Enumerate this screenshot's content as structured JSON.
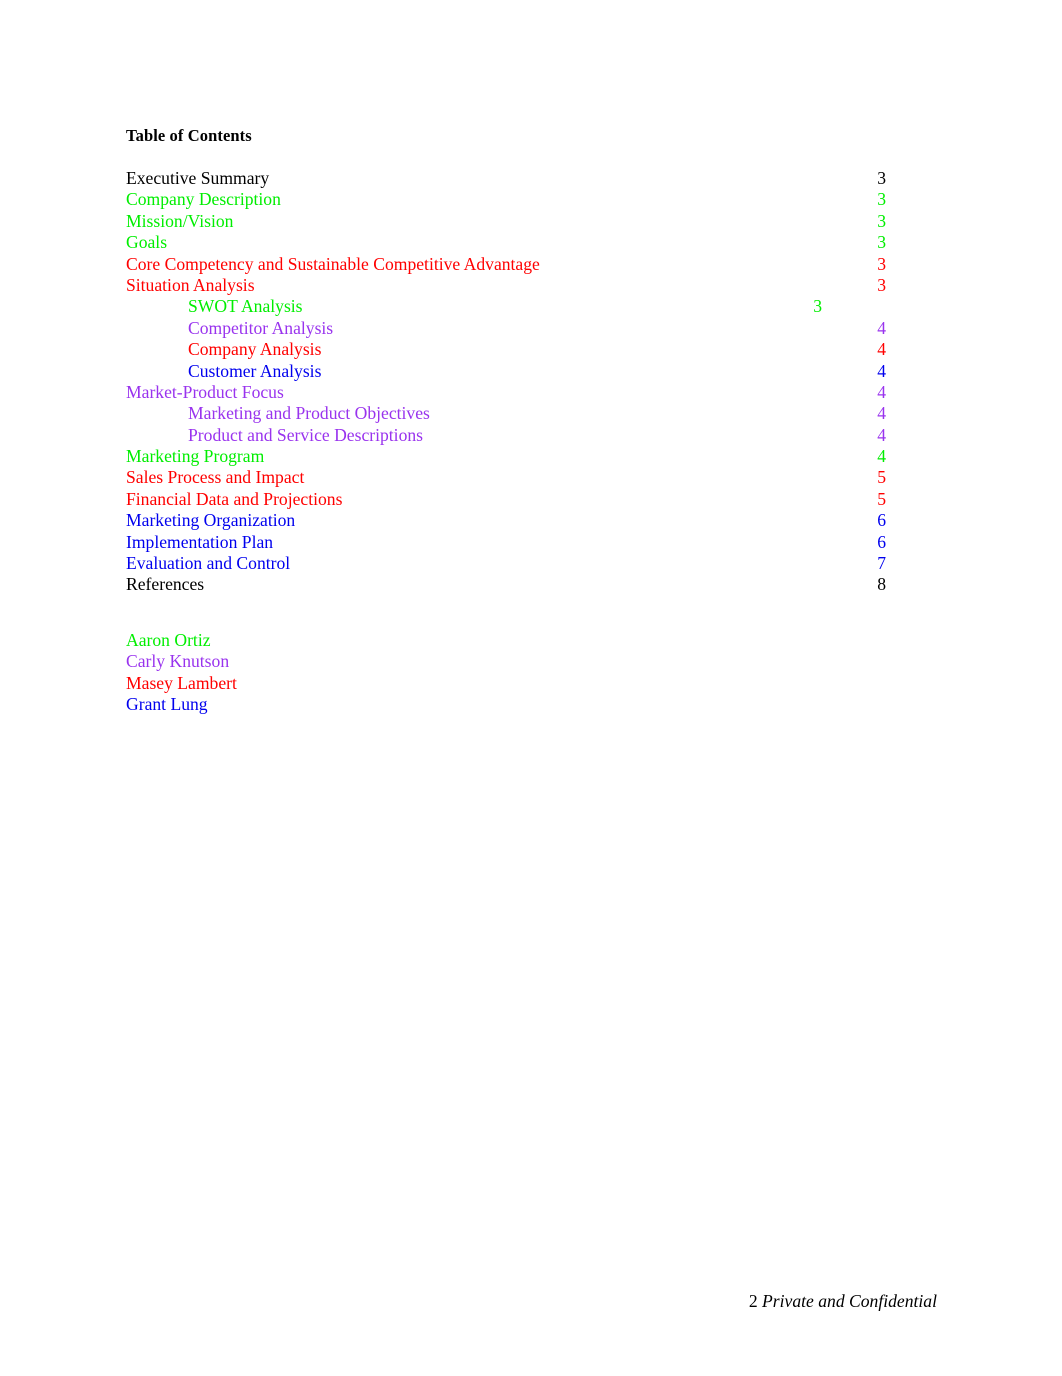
{
  "document": {
    "heading": "Table of Contents",
    "page_footer": {
      "page_number": "2",
      "label": "Private and Confidential"
    }
  },
  "colors": {
    "black": "#000000",
    "green": "#00EE00",
    "red": "#FF0000",
    "purple": "#9933EE",
    "blue": "#0000EE"
  },
  "toc": {
    "entries": [
      {
        "title": "Executive Summary",
        "page": "3",
        "level": 1,
        "color": "#000000",
        "page_color": "#000000",
        "page_align": "right"
      },
      {
        "title": "Company Description",
        "page": "3",
        "level": 1,
        "color": "#00EE00",
        "page_color": "#00EE00",
        "page_align": "right"
      },
      {
        "title": "Mission/Vision",
        "page": "3",
        "level": 1,
        "color": "#00EE00",
        "page_color": "#00EE00",
        "page_align": "right"
      },
      {
        "title": "Goals",
        "page": "3",
        "level": 1,
        "color": "#00EE00",
        "page_color": "#00EE00",
        "page_align": "right"
      },
      {
        "title": "Core Competency and Sustainable Competitive Advantage",
        "page": "3",
        "level": 1,
        "color": "#FF0000",
        "page_color": "#FF0000",
        "page_align": "right"
      },
      {
        "title": "Situation Analysis",
        "page": "3",
        "level": 1,
        "color": "#FF0000",
        "page_color": "#FF0000",
        "page_align": "right"
      },
      {
        "title": "SWOT Analysis",
        "page": "3",
        "level": 2,
        "color": "#00EE00",
        "page_color": "#00EE00",
        "page_align": "mid"
      },
      {
        "title": "Competitor Analysis",
        "page": "4",
        "level": 2,
        "color": "#9933EE",
        "page_color": "#9933EE",
        "page_align": "right"
      },
      {
        "title": "Company Analysis",
        "page": "4",
        "level": 2,
        "color": "#FF0000",
        "page_color": "#FF0000",
        "page_align": "right"
      },
      {
        "title": "Customer Analysis",
        "page": "4",
        "level": 2,
        "color": "#0000EE",
        "page_color": "#0000EE",
        "page_align": "right"
      },
      {
        "title": "Market-Product Focus",
        "page": "4",
        "level": 1,
        "color": "#9933EE",
        "page_color": "#9933EE",
        "page_align": "right"
      },
      {
        "title": "Marketing and Product Objectives",
        "page": "4",
        "level": 2,
        "color": "#9933EE",
        "page_color": "#9933EE",
        "page_align": "right"
      },
      {
        "title": "Product and Service Descriptions",
        "page": "4",
        "level": 2,
        "color": "#9933EE",
        "page_color": "#9933EE",
        "page_align": "right"
      },
      {
        "title": "Marketing Program",
        "page": "4",
        "level": 1,
        "color": "#00EE00",
        "page_color": "#00EE00",
        "page_align": "right"
      },
      {
        "title": "Sales Process and Impact",
        "page": "5",
        "level": 1,
        "color": "#FF0000",
        "page_color": "#FF0000",
        "page_align": "right"
      },
      {
        "title": "Financial Data and Projections",
        "page": "5",
        "level": 1,
        "color": "#FF0000",
        "page_color": "#FF0000",
        "page_align": "right"
      },
      {
        "title": "Marketing Organization",
        "page": "6",
        "level": 1,
        "color": "#0000EE",
        "page_color": "#0000EE",
        "page_align": "right"
      },
      {
        "title": "Implementation Plan",
        "page": "6",
        "level": 1,
        "color": "#0000EE",
        "page_color": "#0000EE",
        "page_align": "right"
      },
      {
        "title": "Evaluation and Control",
        "page": "7",
        "level": 1,
        "color": "#0000EE",
        "page_color": "#0000EE",
        "page_align": "right"
      },
      {
        "title": "References",
        "page": "8",
        "level": 1,
        "color": "#000000",
        "page_color": "#000000",
        "page_align": "right"
      }
    ]
  },
  "authors": {
    "list": [
      {
        "name": "Aaron Ortiz",
        "color": "#00EE00"
      },
      {
        "name": "Carly Knutson",
        "color": "#9933EE"
      },
      {
        "name": "Masey Lambert",
        "color": "#FF0000"
      },
      {
        "name": "Grant Lung",
        "color": "#0000EE"
      }
    ]
  }
}
